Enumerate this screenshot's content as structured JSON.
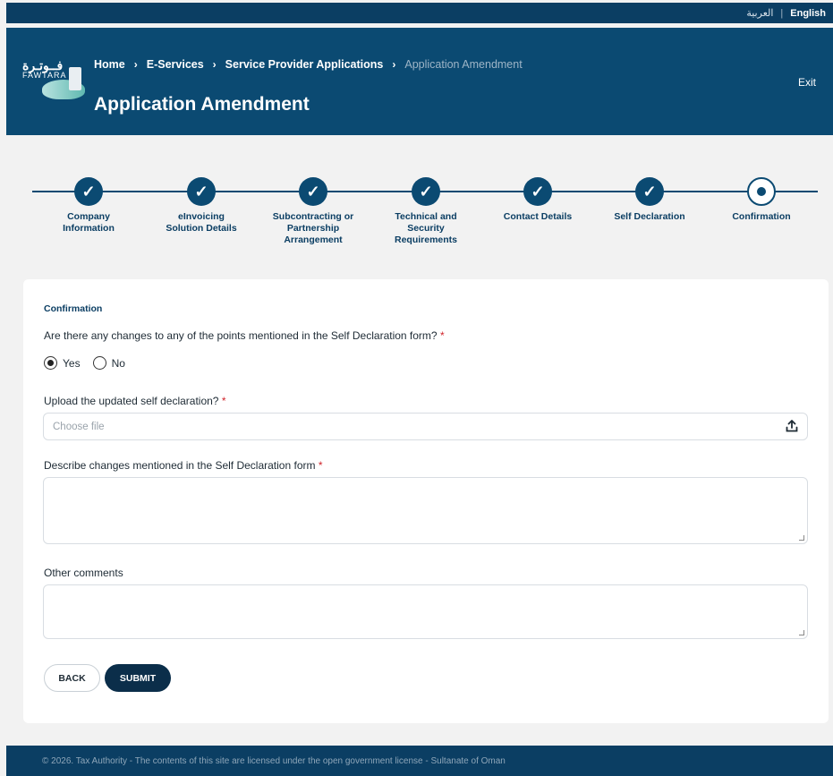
{
  "topbar": {
    "lang_ar": "العربية",
    "lang_sep": "|",
    "lang_en": "English"
  },
  "logo": {
    "arabic": "فــوتـرة",
    "latin": "FAWTARA"
  },
  "breadcrumb": {
    "items": [
      "Home",
      "E-Services",
      "Service Provider Applications"
    ],
    "current": "Application Amendment",
    "sep": "›"
  },
  "header": {
    "title": "Application Amendment",
    "exit": "Exit"
  },
  "steps": [
    {
      "label": "Company\nInformation",
      "state": "done"
    },
    {
      "label": "eInvoicing\nSolution Details",
      "state": "done"
    },
    {
      "label": "Subcontracting or\nPartnership\nArrangement",
      "state": "done"
    },
    {
      "label": "Technical and\nSecurity\nRequirements",
      "state": "done"
    },
    {
      "label": "Contact Details",
      "state": "done"
    },
    {
      "label": "Self Declaration",
      "state": "done"
    },
    {
      "label": "Confirmation",
      "state": "current"
    }
  ],
  "form": {
    "section_title": "Confirmation",
    "q1": "Are there any changes to any of the points mentioned in the Self Declaration form?",
    "required_mark": "*",
    "yes": "Yes",
    "no": "No",
    "selected": "Yes",
    "q2": "Upload the updated self declaration?",
    "file_placeholder": "Choose file",
    "q3": "Describe changes mentioned in the Self Declaration form",
    "q4": "Other comments",
    "back": "BACK",
    "submit": "SUBMIT"
  },
  "colors": {
    "primary": "#0b4a72",
    "dark": "#0b2e4a",
    "required": "#d0242b"
  },
  "footer": {
    "text": "© 2026. Tax Authority - The contents of this site are licensed under the open government license - Sultanate of Oman"
  }
}
